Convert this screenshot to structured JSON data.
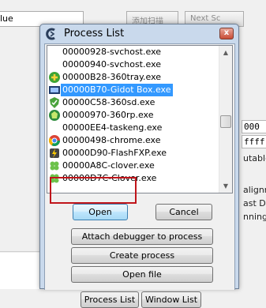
{
  "background": {
    "combo_value": "lue",
    "button_1": "添加扫描",
    "button_2": "Next Sc",
    "side_texts": [
      "alignme",
      "ast Di",
      "nning"
    ],
    "field_1": "000",
    "field_2": "ffff",
    "field_3": "utable"
  },
  "dialog": {
    "title": "Process List",
    "close_label": "x"
  },
  "process_list": {
    "items": [
      {
        "label": "00000928-svchost.exe",
        "icon": "none"
      },
      {
        "label": "00000940-svchost.exe",
        "icon": "none"
      },
      {
        "label": "00000B28-360tray.exe",
        "icon": "360-tray-icon"
      },
      {
        "label": "00000B70-Gidot Box.exe",
        "icon": "gidot-box-icon",
        "selected": true
      },
      {
        "label": "00000C58-360sd.exe",
        "icon": "360sd-shield-icon"
      },
      {
        "label": "00000970-360rp.exe",
        "icon": "360rp-icon"
      },
      {
        "label": "00000EE4-taskeng.exe",
        "icon": "none"
      },
      {
        "label": "00000498-chrome.exe",
        "icon": "chrome-icon"
      },
      {
        "label": "00000D90-FlashFXP.exe",
        "icon": "flashfxp-icon"
      },
      {
        "label": "00000A8C-clover.exe",
        "icon": "clover-icon"
      },
      {
        "label": "00000D7C-Clover.exe",
        "icon": "clover-icon"
      }
    ]
  },
  "buttons": {
    "open": "Open",
    "cancel": "Cancel",
    "attach": "Attach debugger to process",
    "create": "Create process",
    "open_file": "Open file",
    "process_list_tab": "Process List",
    "window_list_tab": "Window List"
  },
  "colors": {
    "selection": "#3399ff",
    "dialog_frame": "#c9d9ec",
    "highlight_box": "#c0151b"
  }
}
